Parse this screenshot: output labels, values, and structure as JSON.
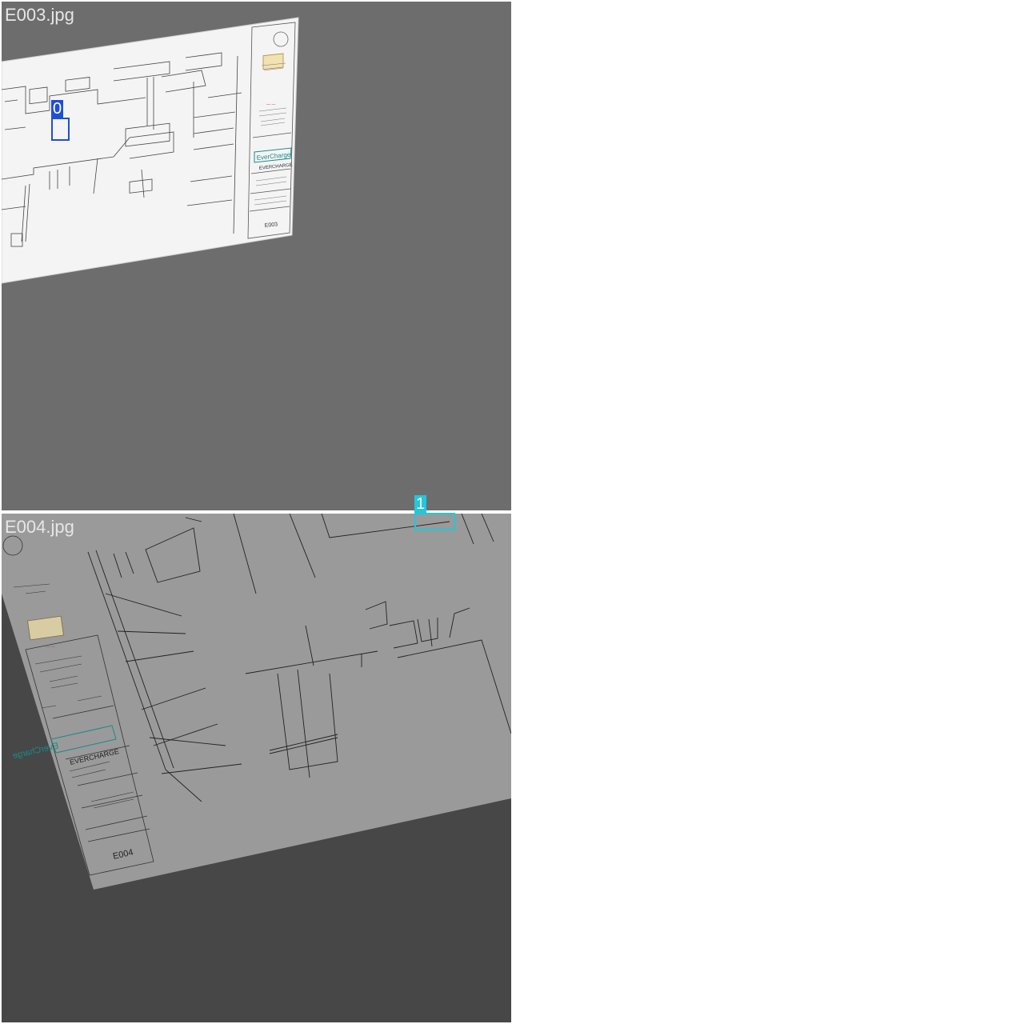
{
  "panels": [
    {
      "filename": "E003.jpg",
      "sheet": {
        "company": "EverCharge",
        "company_caps": "EVERCHARGE",
        "sheet_number": "E003"
      }
    },
    {
      "filename": "E004.jpg",
      "sheet": {
        "company": "EverCharge",
        "company_caps": "EVERCHARGE",
        "sheet_number": "E004"
      }
    }
  ],
  "detections": [
    {
      "label": "0",
      "color": "#1f4fd6"
    },
    {
      "label": "1",
      "color": "#20c8dc"
    }
  ],
  "colors": {
    "top_background": "#6d6d6d",
    "bottom_background": "#474747",
    "sheet_top": "#f4f4f4",
    "sheet_bottom": "#9a9a9a",
    "brand_teal": "#1a8a8a"
  }
}
